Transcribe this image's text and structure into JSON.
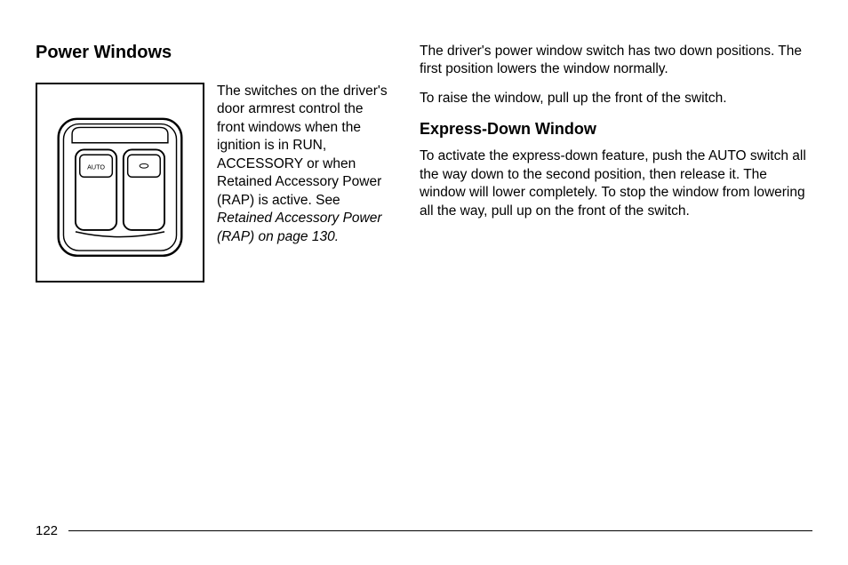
{
  "left": {
    "heading": "Power Windows",
    "intro_text_part1": "The switches on the driver's door armrest control the front windows when the ignition is in RUN, ACCESSORY or when Retained Accessory Power (RAP) is active. See ",
    "intro_text_italic": "Retained Accessory Power (RAP) on page 130.",
    "switch_label": "AUTO"
  },
  "right": {
    "para1": "The driver's power window switch has two down positions. The first position lowers the window normally.",
    "para2": "To raise the window, pull up the front of the switch.",
    "subheading": "Express-Down Window",
    "para3": "To activate the express-down feature, push the AUTO switch all the way down to the second position, then release it. The window will lower completely. To stop the window from lowering all the way, pull up on the front of the switch."
  },
  "page_number": "122"
}
